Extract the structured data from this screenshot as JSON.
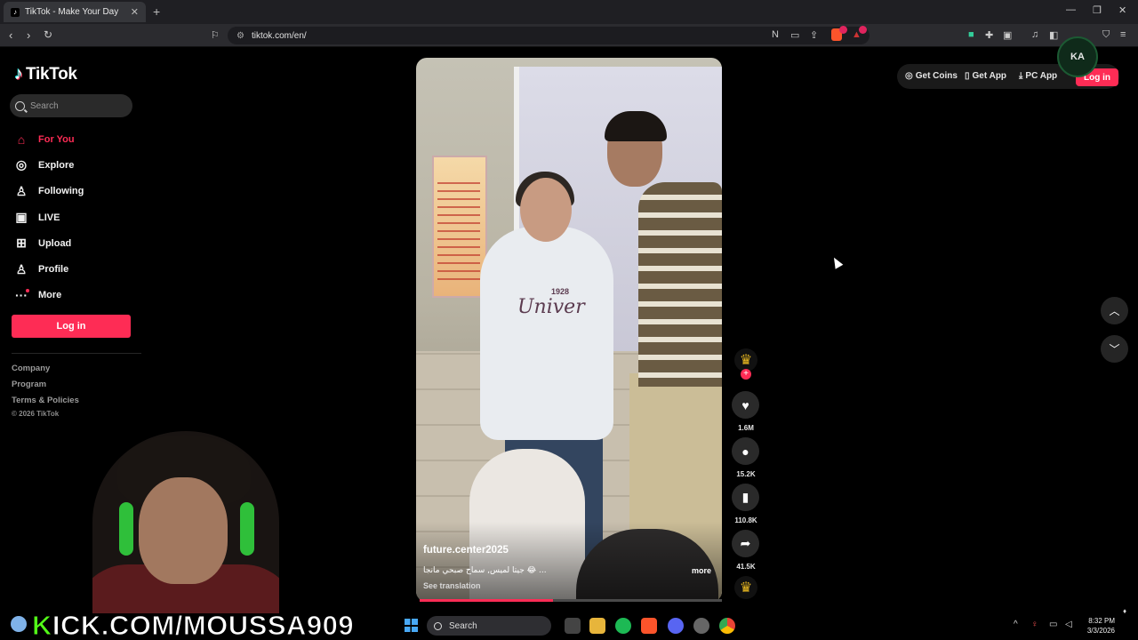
{
  "browser": {
    "tab_title": "TikTok - Make Your Day",
    "url": "tiktok.com/en/"
  },
  "sidebar": {
    "logo": "TikTok",
    "search_placeholder": "Search",
    "items": [
      {
        "label": "For You",
        "icon": "home-icon",
        "active": true
      },
      {
        "label": "Explore",
        "icon": "compass-icon"
      },
      {
        "label": "Following",
        "icon": "person-check-icon"
      },
      {
        "label": "LIVE",
        "icon": "live-tv-icon"
      },
      {
        "label": "Upload",
        "icon": "plus-square-icon"
      },
      {
        "label": "Profile",
        "icon": "person-icon"
      },
      {
        "label": "More",
        "icon": "ellipsis-icon"
      }
    ],
    "login_label": "Log in",
    "footer": [
      "Company",
      "Program",
      "Terms & Policies"
    ],
    "copyright": "© 2026 TikTok"
  },
  "video": {
    "author": "future.center2025",
    "caption": "جيتا لميس, سماح صبحي مانجا 😂 ...",
    "see_translation": "See translation",
    "more": "more",
    "progress": 0.44,
    "shirt_text": "Univer",
    "shirt_number": "1928"
  },
  "actions": {
    "likes": "1.6M",
    "comments": "15.2K",
    "saves": "110.8K",
    "shares": "41.5K"
  },
  "header": {
    "get_coins": "Get Coins",
    "get_app": "Get App",
    "pc_app": "PC App",
    "login": "Log in",
    "streamer_logo_text": "KA"
  },
  "overlay": {
    "kick_prefix": "K",
    "kick_rest": "ICK.COM/MOUSSA909"
  },
  "taskbar": {
    "search": "Search",
    "time": "8:32 PM",
    "date": "3/3/2026"
  },
  "colors": {
    "accent": "#fe2c55",
    "kick_green": "#53fc18"
  }
}
